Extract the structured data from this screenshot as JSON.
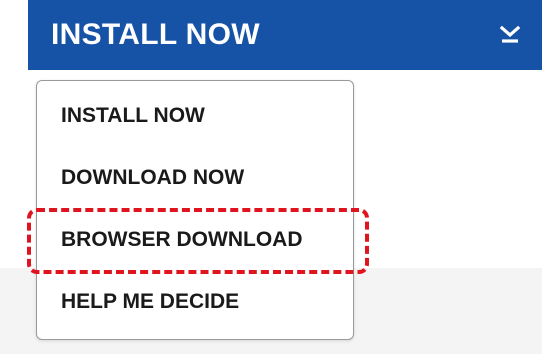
{
  "install_bar": {
    "label": "INSTALL NOW",
    "icon": "chevron-down-icon"
  },
  "menu": {
    "items": [
      {
        "label": "INSTALL NOW"
      },
      {
        "label": "DOWNLOAD NOW"
      },
      {
        "label": "BROWSER DOWNLOAD"
      },
      {
        "label": "HELP ME DECIDE"
      }
    ],
    "highlighted_item": "BROWSER DOWNLOAD"
  },
  "colors": {
    "bar_background": "#1652a6",
    "bar_text": "#ffffff",
    "highlight": "#e0141e",
    "menu_border": "#9a9a9a",
    "menu_text": "#1a1a1a"
  }
}
